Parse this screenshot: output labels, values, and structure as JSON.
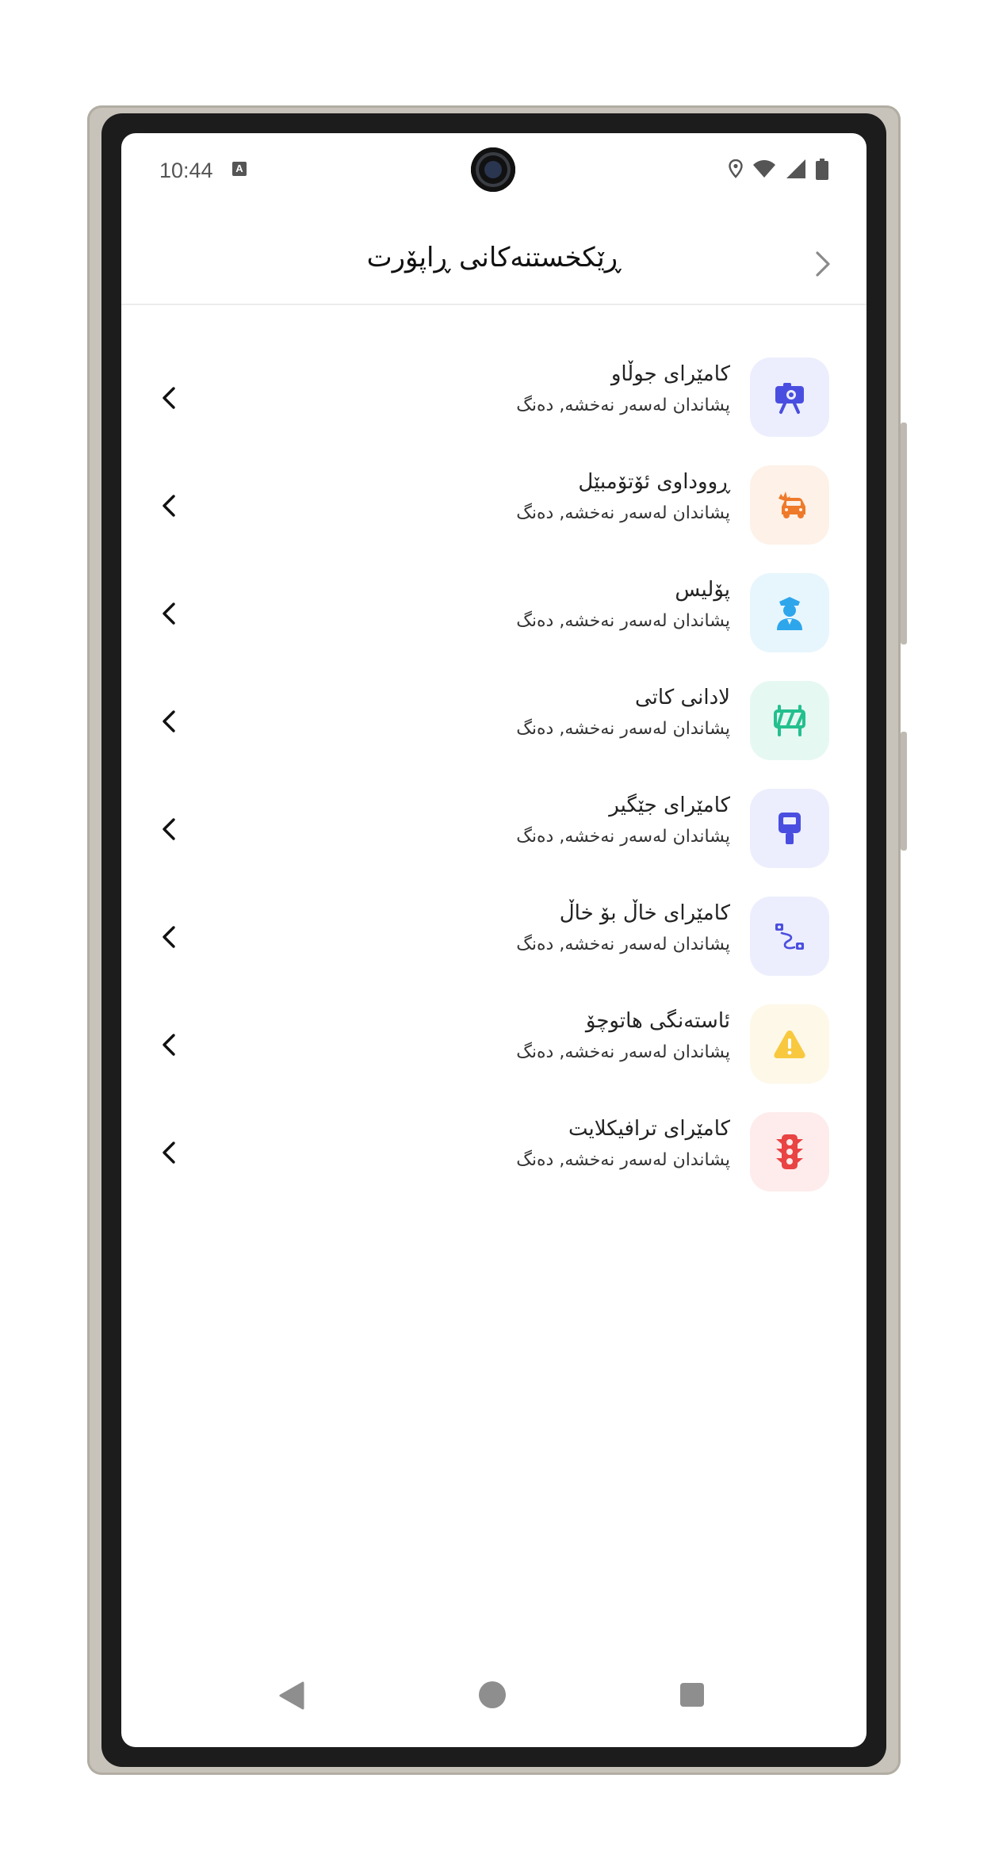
{
  "status_bar": {
    "time": "10:44",
    "indicator_letter": "A",
    "icons": [
      "location-icon",
      "wifi-icon",
      "signal-icon",
      "battery-icon"
    ]
  },
  "header": {
    "title": "ڕێکخستنەکانی ڕاپۆرت",
    "back_icon": "chevron-right-icon"
  },
  "items": [
    {
      "title": "کامێرای جوڵاو",
      "subtitle": "پشاندان لەسەر نەخشە, دەنگ",
      "icon": "mobile-camera-icon",
      "tile_color": "#eceefd",
      "icon_color": "#4a4ee0"
    },
    {
      "title": "ڕووداوی ئۆتۆمبێل",
      "subtitle": "پشاندان لەسەر نەخشە, دەنگ",
      "icon": "car-accident-icon",
      "tile_color": "#fdf1e8",
      "icon_color": "#ee7a2a"
    },
    {
      "title": "پۆلیس",
      "subtitle": "پشاندان لەسەر نەخشە, دەنگ",
      "icon": "police-icon",
      "tile_color": "#e7f6fd",
      "icon_color": "#2ea6ec"
    },
    {
      "title": "لادانی کاتی",
      "subtitle": "پشاندان لەسەر نەخشە, دەنگ",
      "icon": "roadblock-icon",
      "tile_color": "#e6f8f2",
      "icon_color": "#23c08e"
    },
    {
      "title": "کامێرای جێگیر",
      "subtitle": "پشاندان لەسەر نەخشە, دەنگ",
      "icon": "fixed-camera-icon",
      "tile_color": "#eceefd",
      "icon_color": "#4a4ee0"
    },
    {
      "title": "کامێرای خاڵ بۆ خاڵ",
      "subtitle": "پشاندان لەسەر نەخشە, دەنگ",
      "icon": "point-to-point-icon",
      "tile_color": "#eceefd",
      "icon_color": "#4a4ee0"
    },
    {
      "title": "ئاستەنگی هاتوچۆ",
      "subtitle": "پشاندان لەسەر نەخشە, دەنگ",
      "icon": "warning-icon",
      "tile_color": "#fdf8e8",
      "icon_color": "#f8c93f"
    },
    {
      "title": "کامێرای ترافیکلایت",
      "subtitle": "پشاندان لەسەر نەخشە, دەنگ",
      "icon": "traffic-light-icon",
      "tile_color": "#fdeceb",
      "icon_color": "#e94343"
    }
  ],
  "nav_bar": {
    "icons": [
      "nav-back-icon",
      "nav-home-icon",
      "nav-recent-icon"
    ]
  }
}
